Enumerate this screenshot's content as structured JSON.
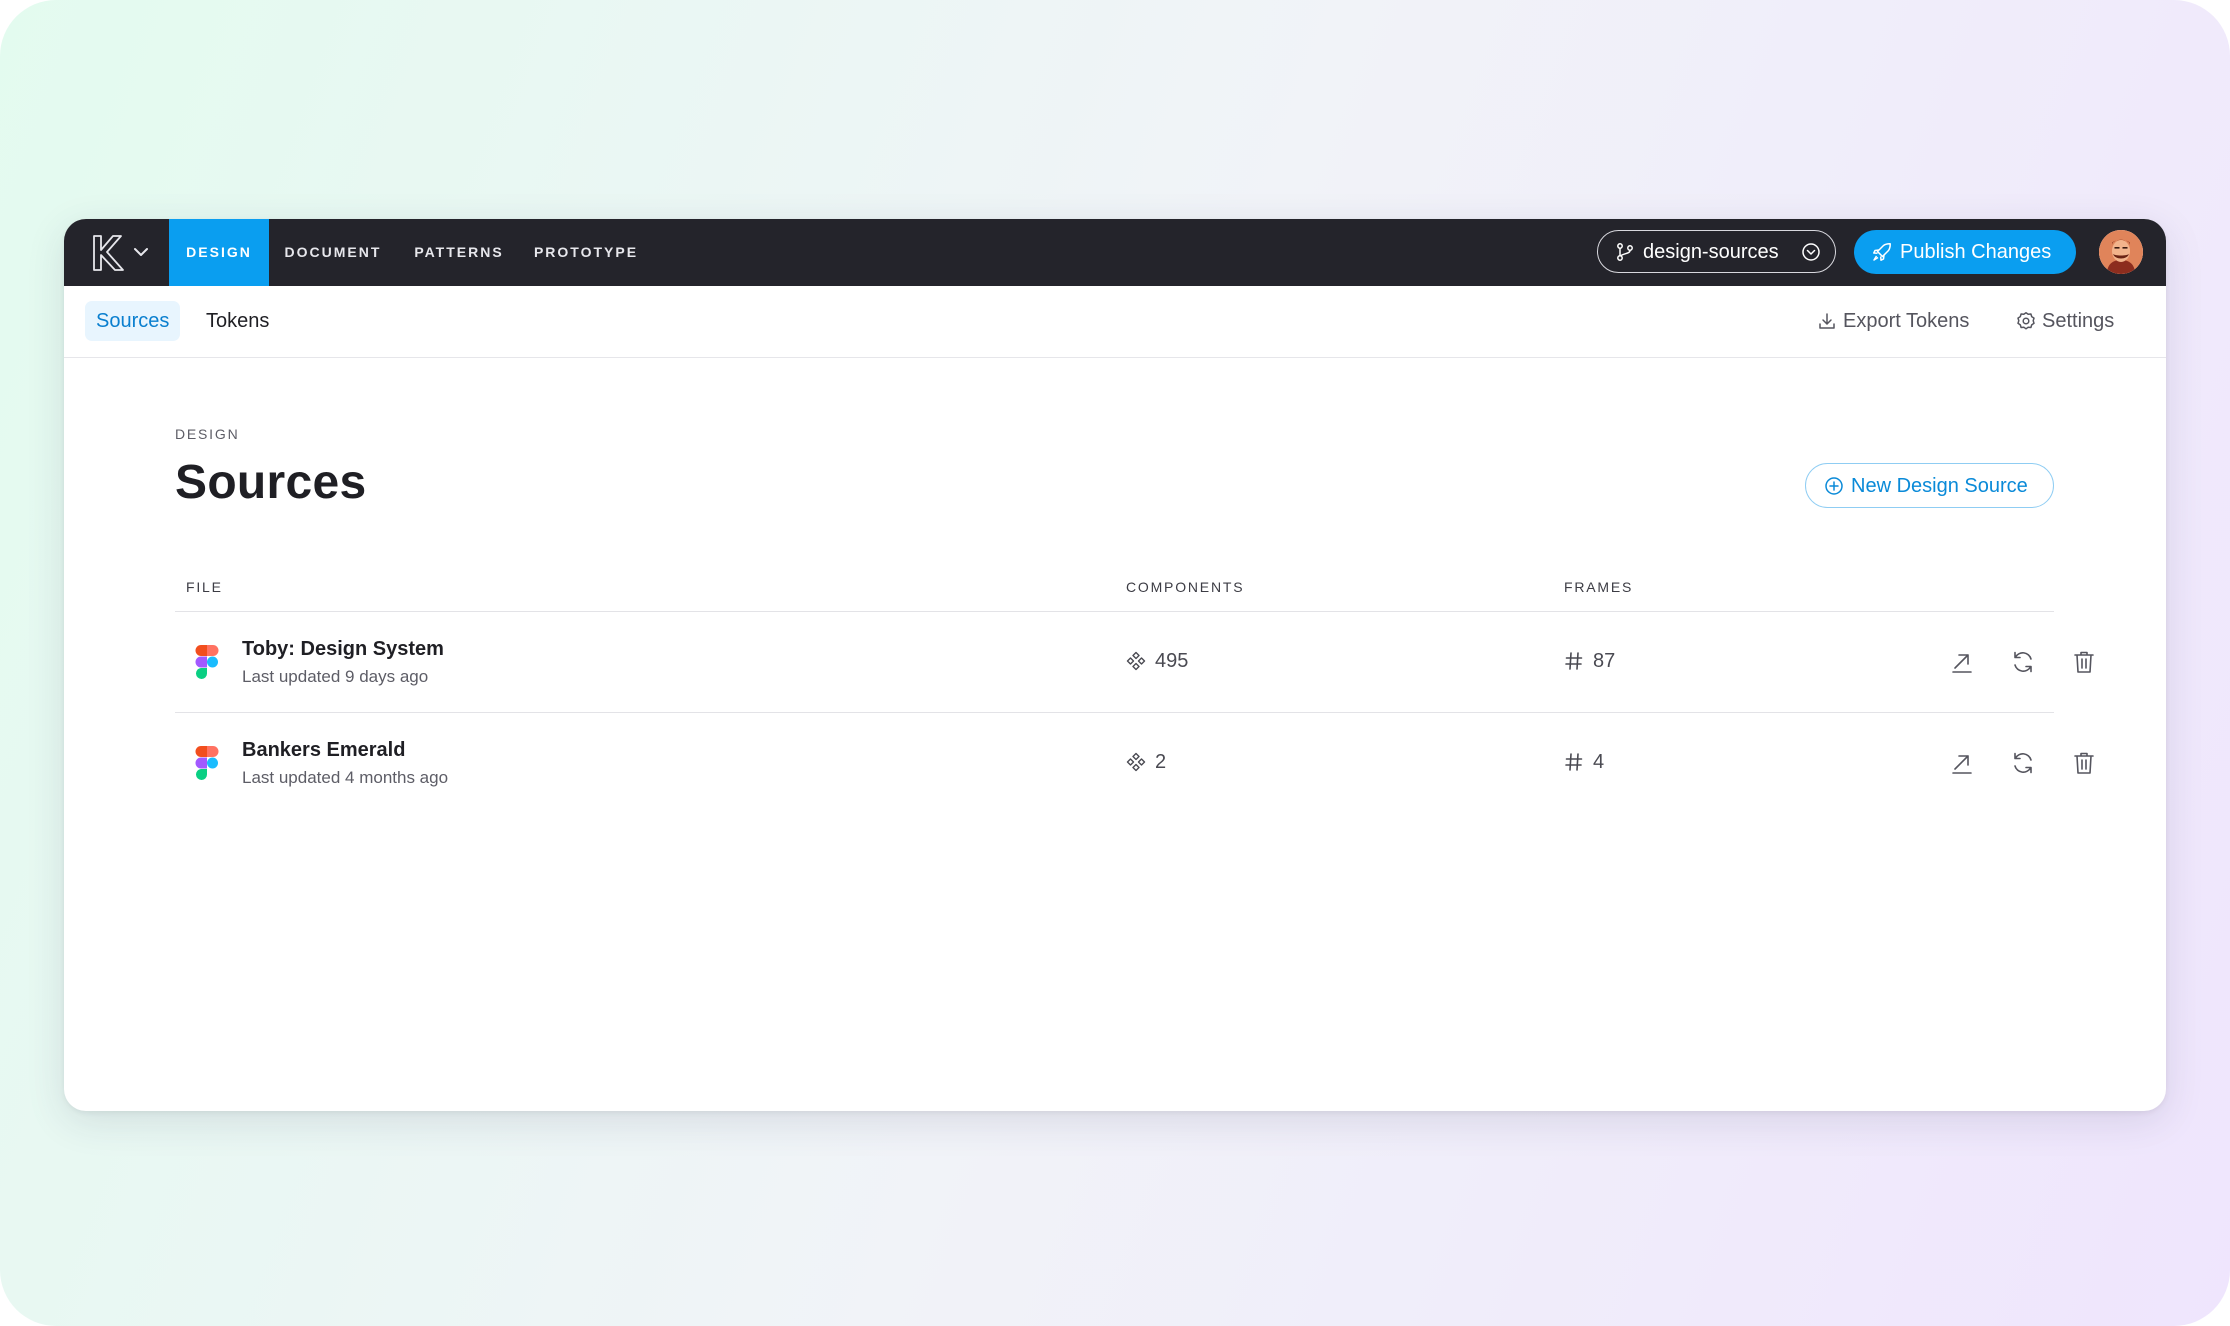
{
  "nav": {
    "tabs": [
      {
        "label": "DESIGN",
        "active": true
      },
      {
        "label": "DOCUMENT",
        "active": false
      },
      {
        "label": "PATTERNS",
        "active": false
      },
      {
        "label": "PROTOTYPE",
        "active": false
      }
    ],
    "branch": "design-sources",
    "publish_label": "Publish Changes",
    "logo_icon": "k-logo-icon"
  },
  "subnav": {
    "tabs": [
      {
        "label": "Sources",
        "active": true
      },
      {
        "label": "Tokens",
        "active": false
      }
    ],
    "export_label": "Export Tokens",
    "settings_label": "Settings"
  },
  "page": {
    "eyebrow": "DESIGN",
    "title": "Sources",
    "new_source_label": "New Design Source"
  },
  "table": {
    "headers": {
      "file": "FILE",
      "components": "COMPONENTS",
      "frames": "FRAMES"
    },
    "rows": [
      {
        "name": "Toby: Design System",
        "updated": "Last updated 9 days ago",
        "components": "495",
        "frames": "87"
      },
      {
        "name": "Bankers Emerald",
        "updated": "Last updated 4 months ago",
        "components": "2",
        "frames": "4"
      }
    ]
  },
  "colors": {
    "accent": "#0a9ef0",
    "topbar": "#24242b",
    "subtab_active_bg": "#e8f5fe"
  }
}
